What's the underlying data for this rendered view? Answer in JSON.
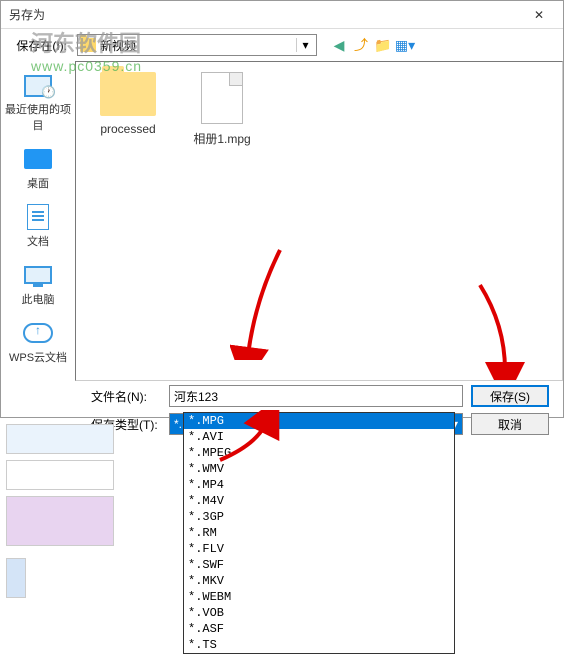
{
  "dialog": {
    "title": "另存为",
    "close": "✕"
  },
  "toolbar": {
    "save_in_label": "保存在(I):",
    "location": "新视频"
  },
  "sidebar": {
    "items": [
      {
        "label": "最近使用的项目"
      },
      {
        "label": "桌面"
      },
      {
        "label": "文档"
      },
      {
        "label": "此电脑"
      },
      {
        "label": "WPS云文档"
      }
    ]
  },
  "files": [
    {
      "name": "processed",
      "type": "folder"
    },
    {
      "name": "相册1.mpg",
      "type": "file"
    }
  ],
  "controls": {
    "filename_label": "文件名(N):",
    "filename_value": "河东123",
    "filetype_label": "保存类型(T):",
    "filetype_value": "*.MPG",
    "save_btn": "保存(S)",
    "cancel_btn": "取消"
  },
  "filetypes": [
    "*.MPG",
    "*.AVI",
    "*.MPEG",
    "*.WMV",
    "*.MP4",
    "*.M4V",
    "*.3GP",
    "*.RM",
    "*.FLV",
    "*.SWF",
    "*.MKV",
    "*.WEBM",
    "*.VOB",
    "*.ASF",
    "*.TS"
  ],
  "watermark": {
    "text": "河东软件园",
    "url": "www.pc0359.cn"
  }
}
